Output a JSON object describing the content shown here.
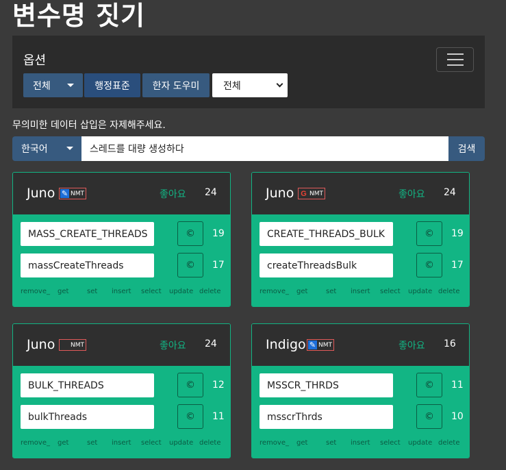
{
  "title": "변수명 짓기",
  "options": {
    "title": "옵션",
    "all_label": "전체",
    "standard_label": "행정표준",
    "hanja_label": "한자 도우미",
    "select_value": "전체"
  },
  "notice": "무의미한 데이터 삽입은 자제해주세요.",
  "search": {
    "lang": "한국어",
    "query": "스레드를 대량 생성하다",
    "button": "검색"
  },
  "like_label": "좋아요",
  "copy_icon": "©",
  "tags": [
    "remove_",
    "get",
    "set",
    "insert",
    "select",
    "update",
    "delete"
  ],
  "cards": [
    {
      "engine": "Juno",
      "badge": "NMT",
      "likes": "24",
      "row1": "MASS_CREATE_THREADS",
      "count1": "19",
      "row2": "massCreateThreads",
      "count2": "17"
    },
    {
      "engine": "Juno",
      "badge": "NMT",
      "likes": "24",
      "row1": "CREATE_THREADS_BULK",
      "count1": "19",
      "row2": "createThreadsBulk",
      "count2": "17"
    },
    {
      "engine": "Juno",
      "badge": "NMT",
      "likes": "24",
      "row1": "BULK_THREADS",
      "count1": "12",
      "row2": "bulkThreads",
      "count2": "11"
    },
    {
      "engine": "Indigo",
      "badge": "NMT",
      "likes": "16",
      "row1": "MSSCR_THRDS",
      "count1": "11",
      "row2": "msscrThrds",
      "count2": "10"
    }
  ]
}
